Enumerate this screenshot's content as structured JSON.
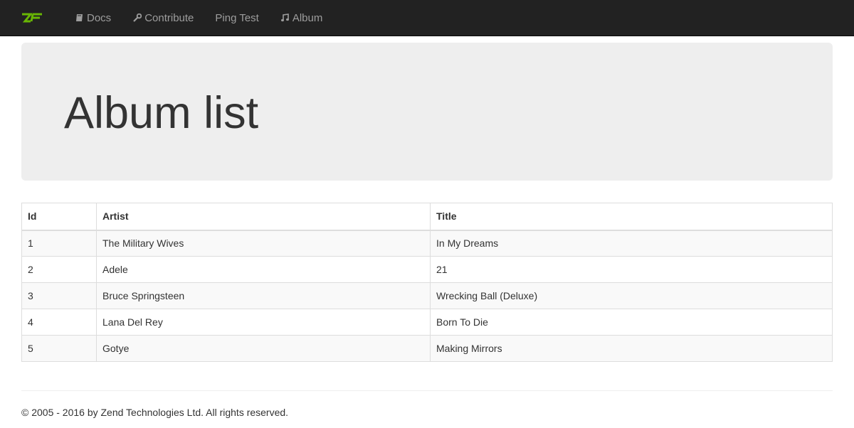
{
  "nav": {
    "brand_icon": "zf-logo-icon",
    "items": [
      {
        "label": "Docs",
        "icon": "book-icon"
      },
      {
        "label": "Contribute",
        "icon": "wrench-icon"
      },
      {
        "label": "Ping Test",
        "icon": ""
      },
      {
        "label": "Album",
        "icon": "music-icon"
      }
    ]
  },
  "page": {
    "title": "Album list"
  },
  "table": {
    "headers": [
      "Id",
      "Artist",
      "Title"
    ],
    "rows": [
      [
        "1",
        "The Military Wives",
        "In My Dreams"
      ],
      [
        "2",
        "Adele",
        "21"
      ],
      [
        "3",
        "Bruce Springsteen",
        "Wrecking Ball (Deluxe)"
      ],
      [
        "4",
        "Lana Del Rey",
        "Born To Die"
      ],
      [
        "5",
        "Gotye",
        "Making Mirrors"
      ]
    ]
  },
  "footer": {
    "text": "© 2005 - 2016 by Zend Technologies Ltd. All rights reserved."
  },
  "colors": {
    "navbar_bg": "#222222",
    "nav_text": "#9d9d9d",
    "brand_green": "#68b604",
    "jumbotron_bg": "#eeeeee"
  }
}
